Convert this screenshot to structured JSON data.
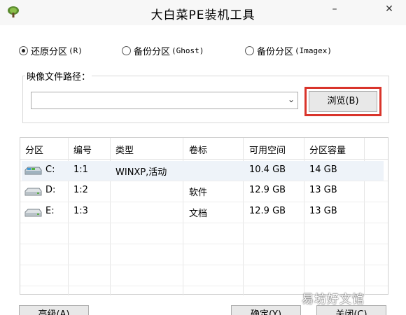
{
  "window": {
    "title": "大白菜PE装机工具",
    "icon": "cabbage-icon",
    "minimize_label": "–",
    "maximize_label": "▭",
    "close_label": "✕"
  },
  "modes": [
    {
      "label": "还原分区",
      "hotkey": "(R)",
      "checked": true
    },
    {
      "label": "备份分区",
      "hotkey": "(Ghost)",
      "checked": false
    },
    {
      "label": "备份分区",
      "hotkey": "(Imagex)",
      "checked": false
    }
  ],
  "image_path": {
    "label": "映像文件路径：",
    "value": "",
    "browse_label": "浏览(B)",
    "highlight_color": "#d9342b"
  },
  "partition_table": {
    "columns": [
      "分区",
      "编号",
      "类型",
      "卷标",
      "可用空间",
      "分区容量"
    ],
    "rows": [
      {
        "drive": "C:",
        "number": "1:1",
        "type": "WINXP,活动",
        "label": "",
        "free": "10.4 GB",
        "capacity": "14 GB",
        "icon": "system-drive-icon",
        "selected": true
      },
      {
        "drive": "D:",
        "number": "1:2",
        "type": "",
        "label": "软件",
        "free": "12.9 GB",
        "capacity": "13 GB",
        "icon": "drive-icon",
        "selected": false
      },
      {
        "drive": "E:",
        "number": "1:3",
        "type": "",
        "label": "文档",
        "free": "12.9 GB",
        "capacity": "13 GB",
        "icon": "drive-icon",
        "selected": false
      }
    ]
  },
  "buttons": {
    "advanced": "高级(A)",
    "ok": "确定(Y)",
    "close": "关闭(C)"
  },
  "watermark": "易坊好文馆"
}
